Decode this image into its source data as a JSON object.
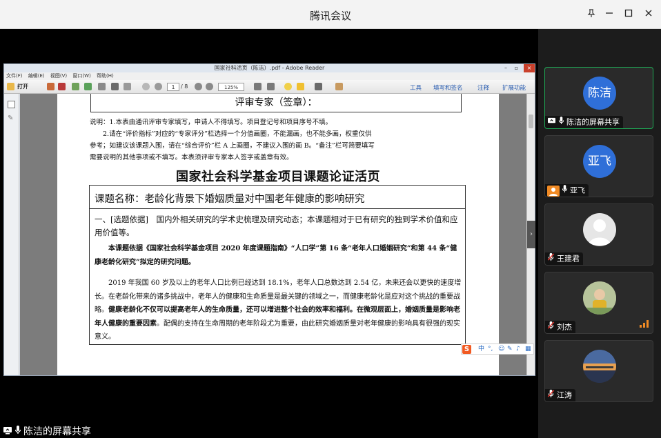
{
  "app": {
    "title": "腾讯会议"
  },
  "window_controls": {
    "pin": "pin-icon",
    "minimize": "minimize-icon",
    "maximize": "maximize-icon",
    "close": "close-icon"
  },
  "reader": {
    "title": "国家社科活页（陈洁）.pdf - Adobe Reader",
    "menu": [
      "文件(F)",
      "编辑(E)",
      "视图(V)",
      "窗口(W)",
      "帮助(H)"
    ],
    "toolbar": {
      "open_label": "打开",
      "page_current": "1",
      "page_total": "/ 8",
      "zoom": "125%",
      "links": [
        "工具",
        "填写和签名",
        "注释",
        "扩展功能"
      ]
    },
    "page": {
      "reviewer_label": "评审专家（签章）：",
      "notes": [
        "说明：1.本表由通讯评审专家填写，申请人不得填写。项目登记号和项目序号不填。",
        "　　2.请在“评价指标”对应的“专家评分”栏选择一个分值画圈，不能漏画，也不能多画，权重仅供",
        "参考；如建议该课题入围，请在“综合评价”栏 A 上画圈，不建议入围的画 B。“备注”栏可简要填写",
        "需要说明的其他事项或不填写。本表须评审专家本人签字或盖章有效。"
      ],
      "heading": "国家社会科学基金项目课题论证活页",
      "project_name": "课题名称：老龄化背景下婚姻质量对中国老年健康的影响研究",
      "section1_prefix": "一、[选题依据]",
      "section1_text": "　国内外相关研究的学术史梳理及研究动态；本课题相对于已有研究的独到学术价值和应用价值等。",
      "para1": "本课题依据《国家社会科学基金项目 2020 年度课题指南》“人口学”第 16 条“老年人口婚姻研究”和第 44 条“健康老龄化研究”拟定的研究问题。",
      "para2_normal": "2019 年我国 60 岁及以上的老年人口比例已经达到 18.1%，老年人口总数达到 2.54 亿，未来还会以更快的速度增长。在老龄化带来的诸多挑战中，老年人的健康和生命质量是最关键的领域之一，而健康老龄化是应对这个挑战的重要战略。",
      "para2_bold": "健康老龄化不仅可以提高老年人的生命质量，还可以增进整个社会的效率和福利。在微观层面上，婚姻质量是影响老年人健康的重要因素",
      "para2_tail": "。配偶的支持在生命周期的老年阶段尤为重要，由此研究婚姻质量对老年健康的影响具有很强的现实意义。"
    }
  },
  "ime": {
    "logo": "S",
    "lang": "中"
  },
  "share_label": "陈洁的屏幕共享",
  "participants": [
    {
      "name": "陈洁的屏幕共享",
      "avatar_text": "陈洁",
      "active": true,
      "status": "screen-share-icon"
    },
    {
      "name": "亚飞",
      "avatar_text": "亚飞",
      "active": false,
      "status": "mic-on-icon"
    },
    {
      "name": "王建君",
      "avatar_text": "",
      "active": false,
      "status": "mic-muted-icon"
    },
    {
      "name": "刘杰",
      "avatar_text": "",
      "active": false,
      "status": "mic-muted-icon"
    },
    {
      "name": "江涛",
      "avatar_text": "",
      "active": false,
      "status": "mic-muted-icon"
    }
  ],
  "colors": {
    "avatar_blue": "#2f6fd8",
    "active_border": "#1fa855",
    "titlebar": "#f3f3f3"
  }
}
